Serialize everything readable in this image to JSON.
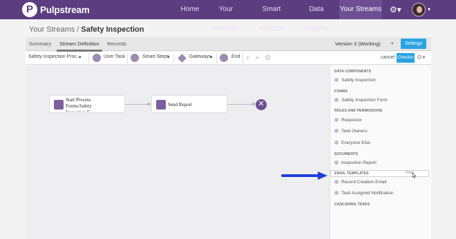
{
  "nav": {
    "brand": "Pulpstream",
    "links": [
      "Home",
      "Your Records",
      "Smart Objects",
      "Data Insights",
      "Your Streams"
    ],
    "active": "Your Streams"
  },
  "breadcrumb": {
    "parent": "Your Streams /",
    "current": "Safety Inspection"
  },
  "tabs": [
    "Summary",
    "Stream Definition",
    "Records"
  ],
  "active_tab": "Stream Definition",
  "version": "Version 3 (Working)",
  "settings_label": "Settings",
  "toolbar": {
    "stream_select": "Safety Inspection Proc...",
    "user_task": "User Task",
    "smart_steps": "Smart Steps",
    "gateways": "Gateways",
    "end": "End",
    "cancel": "cancel",
    "checkin": "Checkin"
  },
  "canvas": {
    "node1_line1": "Start Process",
    "node1_line2": "Forms:Safety",
    "node1_line3": "Inspection F...",
    "node2": "Send Report"
  },
  "panel": {
    "sections": [
      {
        "title": "DATA COMPONENTS",
        "items": [
          "Safety Inspection"
        ]
      },
      {
        "title": "FORMS",
        "items": [
          "Safety Inspection Form"
        ]
      },
      {
        "title": "ROLES AND PERMISSIONS",
        "items": [
          "Requestor",
          "Task Owners",
          "Everyone Else"
        ]
      },
      {
        "title": "DOCUMENTS",
        "items": [
          "Inspection Report"
        ]
      },
      {
        "title": "EMAIL TEMPLATES",
        "items": [
          "Record Creation Email",
          "Task Assigned Notification"
        ]
      },
      {
        "title": "CASCADING TASKS",
        "items": []
      }
    ],
    "new_label": "New"
  },
  "colors": {
    "nav_bg": "#5b3d80",
    "accent_blue": "#29a3e0",
    "node_purple": "#7e5e9f",
    "annotation_arrow": "#1f3fd6"
  },
  "icons": [
    "logo-icon",
    "gear-icon",
    "avatar",
    "user-task-icon",
    "smart-steps-icon",
    "gateway-diamond-icon",
    "end-icon",
    "zoom-in-icon",
    "zoom-out-icon",
    "print-icon",
    "form-icon",
    "email-icon",
    "close-end-icon",
    "dot-icon",
    "arrow-annotation-icon"
  ]
}
